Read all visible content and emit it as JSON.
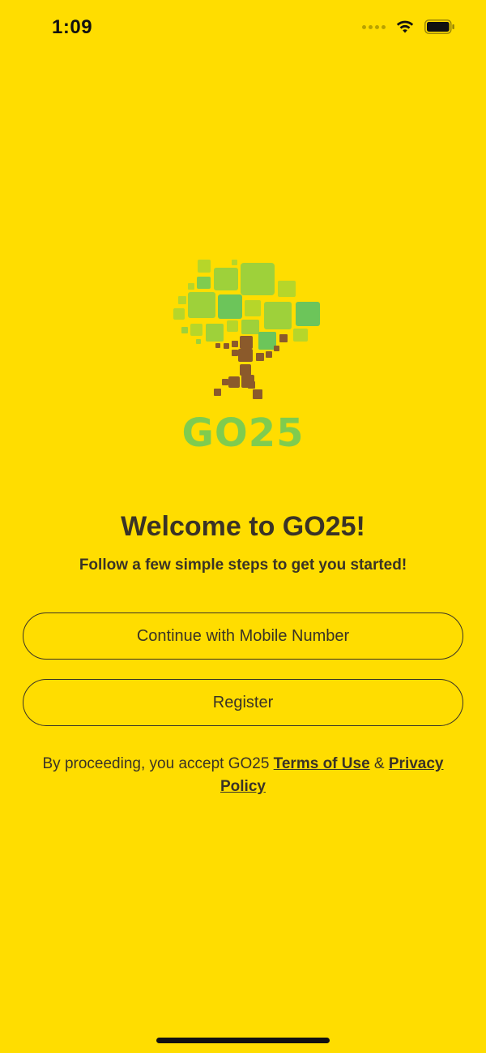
{
  "status_bar": {
    "time": "1:09"
  },
  "logo": {
    "wordmark": "GO25",
    "wordmark_color": "#7FCC4F",
    "leaf_colors": [
      "#9ED13A",
      "#7FCC4F",
      "#6CC55A",
      "#B6D62A"
    ],
    "trunk_color": "#8B5A2B"
  },
  "welcome": {
    "title": "Welcome to GO25!",
    "subtitle": "Follow a few simple steps to get you started!"
  },
  "buttons": {
    "mobile_label": "Continue with Mobile Number",
    "register_label": "Register"
  },
  "legal": {
    "prefix": "By proceeding, you accept GO25 ",
    "terms_label": "Terms of Use",
    "joiner": " & ",
    "privacy_label": "Privacy Policy"
  },
  "colors": {
    "background": "#FFDD00",
    "text": "#3A3326"
  }
}
